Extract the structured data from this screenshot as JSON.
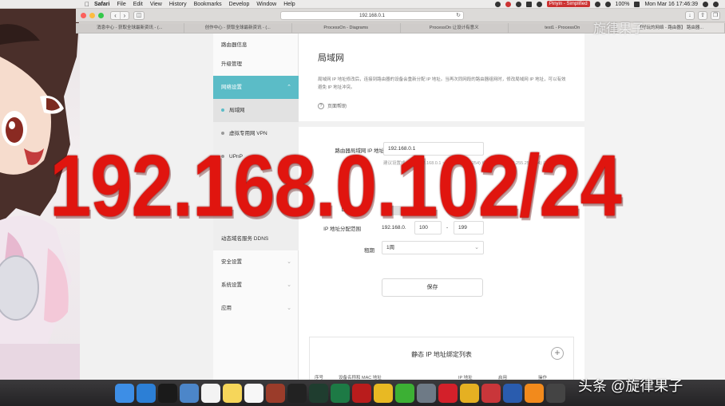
{
  "menubar": {
    "app": "Safari",
    "items": [
      "File",
      "Edit",
      "View",
      "History",
      "Bookmarks",
      "Develop",
      "Window",
      "Help"
    ],
    "battery": "100%",
    "input_source": "Pinyin - Simplified",
    "datetime": "Mon Mar 16  17:46:39"
  },
  "browser": {
    "url": "192.168.0.1",
    "tabs": [
      "消息中心 - 获取全球最新资讯 - (...",
      "创作中心 - 获取全球最新资讯 - (...",
      "ProcessOn - Diagrams",
      "ProcessOn 让设计有意义",
      "test1 - ProcessOn",
      "【好玩的网络 - 路由器】 路由器..."
    ]
  },
  "sidebar": {
    "items": [
      {
        "label": "路由器信息"
      },
      {
        "label": "升级管理"
      },
      {
        "label": "网络设置"
      },
      {
        "label": "局域网"
      },
      {
        "label": "虚拟专用网 VPN"
      },
      {
        "label": "UPnP"
      },
      {
        "label": "动态域名服务 DDNS"
      },
      {
        "label": "安全设置"
      },
      {
        "label": "系统设置"
      },
      {
        "label": "应用"
      }
    ]
  },
  "main": {
    "title": "局域网",
    "description": "局域网 IP 地址修改后，连接到路由器的设备会重新分配 IP 地址。当再次同网段的路由器组网时，修改局域网 IP 地址，可以有效避免 IP 地址冲突。",
    "help": "页面帮助",
    "form": {
      "ip_label": "路由器局域网 IP 地址",
      "ip_value": "192.168.0.1",
      "ip_hint": "建议设置成 (例如 192.168.0.1 ~ 192.168.255.254) 或 (10.0.0.1 ~ 10.255.255.254) 以及 172.16.0.1 ~ 172.31.255.254 或设置 255.255.255.0 的地址段",
      "dhcp_label": "DHCP",
      "range_label": "IP 地址分配范围",
      "range_prefix": "192.168.0.",
      "range_start": "100",
      "range_sep": "-",
      "range_end": "199",
      "lease_label": "租期",
      "lease_value": "1周",
      "save": "保存"
    },
    "binding": {
      "title": "静态 IP 地址绑定列表",
      "columns": [
        "序号",
        "设备名称和 MAC 地址",
        "IP 地址",
        "启用",
        "操作"
      ]
    }
  },
  "overlay": {
    "text": "192.168.0.102/24"
  },
  "watermark": {
    "top": "旋律果子",
    "bottom": "头条 @旋律果子"
  },
  "dock": {
    "icons": [
      {
        "name": "finder-icon",
        "color": "#3d8ee6"
      },
      {
        "name": "safari-icon",
        "color": "#2c7fd6"
      },
      {
        "name": "terminal-icon",
        "color": "#1a1a1a"
      },
      {
        "name": "preview-icon",
        "color": "#4c86c9"
      },
      {
        "name": "calendar-icon",
        "color": "#f3f3f3"
      },
      {
        "name": "notes-icon",
        "color": "#f6d65a"
      },
      {
        "name": "reminders-icon",
        "color": "#f7f7f7"
      },
      {
        "name": "dictionary-icon",
        "color": "#9b3c2a"
      },
      {
        "name": "piano-icon",
        "color": "#222222"
      },
      {
        "name": "activity-monitor-icon",
        "color": "#1f3d2f"
      },
      {
        "name": "excel-icon",
        "color": "#1d7a45"
      },
      {
        "name": "acrobat-icon",
        "color": "#b91c1c"
      },
      {
        "name": "sketch-icon",
        "color": "#e8b923"
      },
      {
        "name": "wechat-icon",
        "color": "#3cb034"
      },
      {
        "name": "tex-icon",
        "color": "#6e7a86"
      },
      {
        "name": "netease-music-icon",
        "color": "#d3202a"
      },
      {
        "name": "chrome-icon",
        "color": "#e5b022"
      },
      {
        "name": "remote-desktop-icon",
        "color": "#c9363a"
      },
      {
        "name": "word-icon",
        "color": "#2a5cae"
      },
      {
        "name": "vlc-icon",
        "color": "#f28a1c"
      },
      {
        "name": "istat-icon",
        "color": "#444444"
      }
    ]
  }
}
